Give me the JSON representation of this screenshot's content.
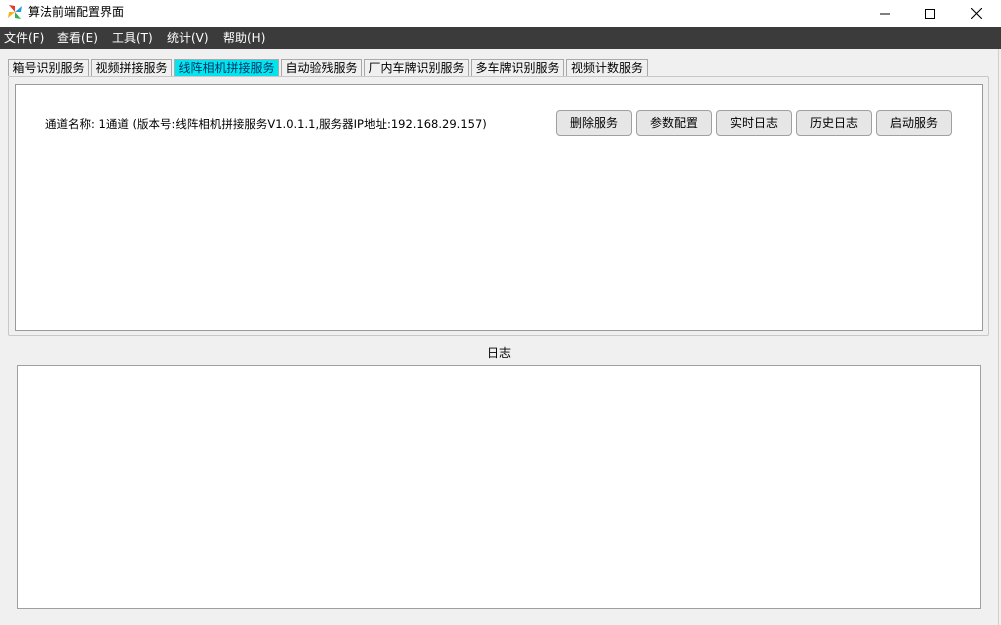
{
  "window": {
    "title": "算法前端配置界面",
    "icon": "pinwheel-app-icon",
    "controls": [
      "minimize-icon",
      "maximize-icon",
      "close-icon"
    ]
  },
  "menu": {
    "file": "文件(F)",
    "view": "查看(E)",
    "tools": "工具(T)",
    "stats": "统计(V)",
    "help": "帮助(H)"
  },
  "tabs": [
    {
      "label": "箱号识别服务",
      "active": false
    },
    {
      "label": "视频拼接服务",
      "active": false
    },
    {
      "label": "线阵相机拼接服务",
      "active": true
    },
    {
      "label": "自动验残服务",
      "active": false
    },
    {
      "label": "厂内车牌识别服务",
      "active": false
    },
    {
      "label": "多车牌识别服务",
      "active": false
    },
    {
      "label": "视频计数服务",
      "active": false
    }
  ],
  "service": {
    "channel_info": "通道名称: 1通道  (版本号:线阵相机拼接服务V1.0.1.1,服务器IP地址:192.168.29.157)",
    "buttons": {
      "delete": "删除服务",
      "params": "参数配置",
      "realtime_log": "实时日志",
      "history_log": "历史日志",
      "start": "启动服务"
    }
  },
  "log": {
    "title": "日志",
    "content": ""
  },
  "colors": {
    "menubar_bg": "#3b3b3b",
    "active_tab_bg": "#00e5ee"
  }
}
